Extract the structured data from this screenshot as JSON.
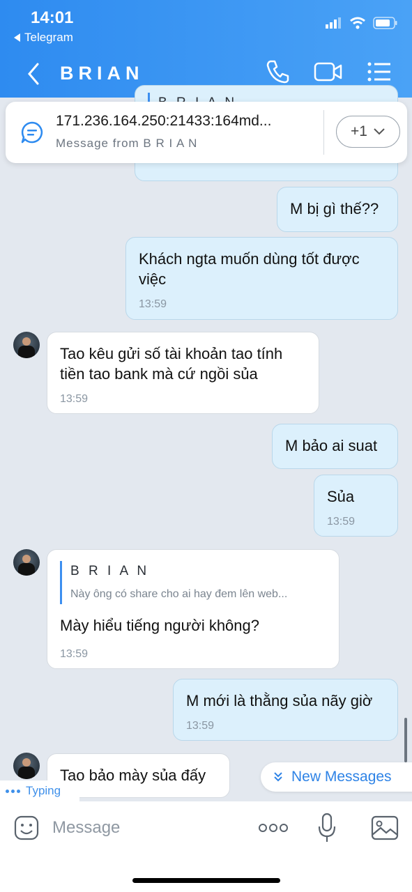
{
  "status_bar": {
    "time": "14:01",
    "back_app": "Telegram"
  },
  "header": {
    "title": "BRIAN"
  },
  "pinned": {
    "text": "171.236.164.250:21433:164md...",
    "subtitle": "Message from B R I A N",
    "count": "+1"
  },
  "top_partial_reply_name": "B R I A N",
  "messages": [
    {
      "text": "M bị gì thế??",
      "time": ""
    },
    {
      "text": "Khách ngta muốn dùng tốt được việc",
      "time": "13:59"
    },
    {
      "text": "Tao kêu gửi số tài khoản tao tính tiền tao bank mà cứ ngồi sủa",
      "time": "13:59"
    },
    {
      "text": "M bảo ai suat",
      "time": ""
    },
    {
      "text": "Sủa",
      "time": "13:59"
    },
    {
      "reply_name": "B R I A N",
      "reply_text": "Này ông có share cho ai hay đem lên web...",
      "text": "Mày hiểu tiếng người không?",
      "time": "13:59"
    },
    {
      "text": "M mới là thằng sủa nãy giờ",
      "time": "13:59"
    },
    {
      "text": "Tao bảo mày sủa đấy",
      "time": ""
    }
  ],
  "new_messages_label": "New Messages",
  "typing_label": "Typing",
  "input": {
    "placeholder": "Message"
  },
  "colors": {
    "accent": "#2e8bf0",
    "outgoing_bubble": "#dcf0fc",
    "incoming_bubble": "#ffffff",
    "background": "#e3e8ef"
  }
}
